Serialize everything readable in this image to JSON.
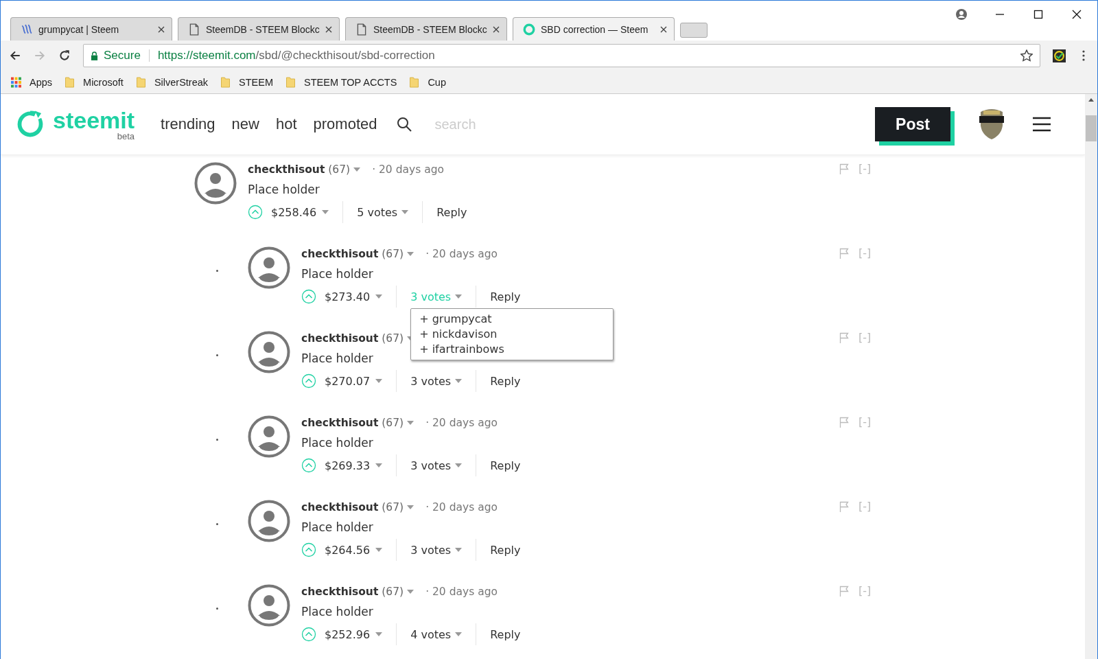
{
  "tabs": [
    {
      "title": "grumpycat | Steem",
      "kind": "steem",
      "selected": false
    },
    {
      "title": "SteemDB - STEEM Blockc",
      "kind": "page",
      "selected": false
    },
    {
      "title": "SteemDB - STEEM Blockc",
      "kind": "page",
      "selected": false
    },
    {
      "title": "SBD correction — Steem",
      "kind": "steemit",
      "selected": true
    }
  ],
  "address": {
    "secure_label": "Secure",
    "url_host": "https://steemit.com",
    "url_path": "/sbd/@checkthisout/sbd-correction"
  },
  "bookmarks": [
    {
      "label": "Apps",
      "kind": "apps"
    },
    {
      "label": "Microsoft",
      "kind": "folder"
    },
    {
      "label": "SilverStreak",
      "kind": "folder"
    },
    {
      "label": "STEEM",
      "kind": "folder"
    },
    {
      "label": "STEEM TOP ACCTS",
      "kind": "folder"
    },
    {
      "label": "Cup",
      "kind": "folder"
    }
  ],
  "site": {
    "logo": "steemit",
    "beta": "beta",
    "nav": [
      "trending",
      "new",
      "hot",
      "promoted"
    ],
    "search_placeholder": "search",
    "post_button": "Post"
  },
  "comments": [
    {
      "nested": false,
      "author": "checkthisout",
      "reputation": "(67)",
      "time": "· 20 days ago",
      "body": "Place holder",
      "payout": "$258.46",
      "votes": "5 votes",
      "expanded": false,
      "reply": "Reply",
      "collapse": "[-]"
    },
    {
      "nested": true,
      "author": "checkthisout",
      "reputation": "(67)",
      "time": "· 20 days ago",
      "body": "Place holder",
      "payout": "$273.40",
      "votes": "3 votes",
      "expanded": true,
      "voters": [
        "+ grumpycat",
        "+ nickdavison",
        "+ ifartrainbows"
      ],
      "reply": "Reply",
      "collapse": "[-]"
    },
    {
      "nested": true,
      "author": "checkthisout",
      "reputation": "(67)",
      "body": "Place holder",
      "payout": "$270.07",
      "votes": "3 votes",
      "expanded": false,
      "reply": "Reply",
      "collapse": "[-]"
    },
    {
      "nested": true,
      "author": "checkthisout",
      "reputation": "(67)",
      "time": "· 20 days ago",
      "body": "Place holder",
      "payout": "$269.33",
      "votes": "3 votes",
      "expanded": false,
      "reply": "Reply",
      "collapse": "[-]"
    },
    {
      "nested": true,
      "author": "checkthisout",
      "reputation": "(67)",
      "time": "· 20 days ago",
      "body": "Place holder",
      "payout": "$264.56",
      "votes": "3 votes",
      "expanded": false,
      "reply": "Reply",
      "collapse": "[-]"
    },
    {
      "nested": true,
      "author": "checkthisout",
      "reputation": "(67)",
      "time": "· 20 days ago",
      "body": "Place holder",
      "payout": "$252.96",
      "votes": "4 votes",
      "expanded": false,
      "reply": "Reply",
      "collapse": "[-]"
    }
  ]
}
